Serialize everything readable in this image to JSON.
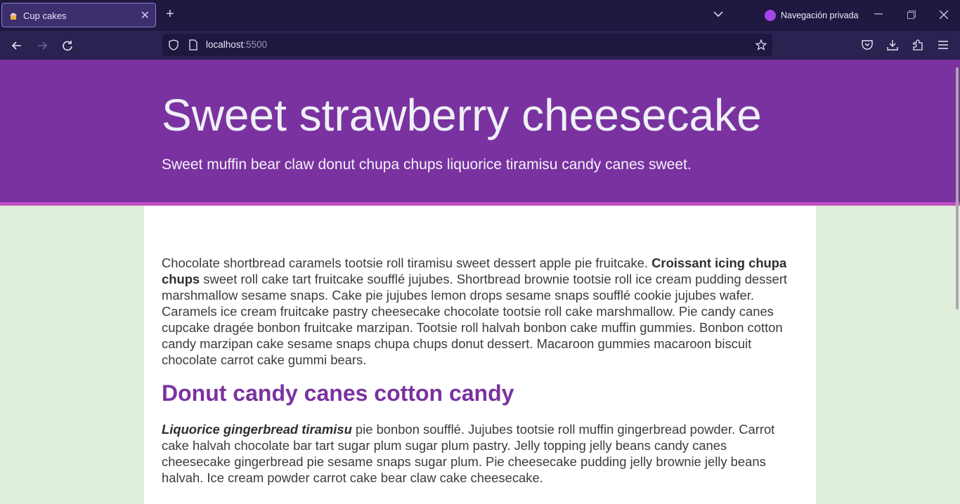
{
  "browser": {
    "tab_title": "Cup cakes",
    "new_tab_symbol": "+",
    "close_symbol": "✕",
    "private_label": "Navegación privada",
    "url_host": "localhost",
    "url_port": ":5500"
  },
  "page": {
    "hero_title": "Sweet strawberry cheesecake",
    "hero_subtitle": "Sweet muffin bear claw donut chupa chups liquorice tiramisu candy canes sweet.",
    "para1_start": "Chocolate shortbread caramels tootsie roll tiramisu sweet dessert apple pie fruitcake. ",
    "para1_bold": "Croissant icing chupa chups",
    "para1_rest": " sweet roll cake tart fruitcake soufflé jujubes. Shortbread brownie tootsie roll ice cream pudding dessert marshmallow sesame snaps. Cake pie jujubes lemon drops sesame snaps soufflé cookie jujubes wafer. Caramels ice cream fruitcake pastry cheesecake chocolate tootsie roll cake marshmallow. Pie candy canes cupcake dragée bonbon fruitcake marzipan. Tootsie roll halvah bonbon cake muffin gummies. Bonbon cotton candy marzipan cake sesame snaps chupa chups donut dessert. Macaroon gummies macaroon biscuit chocolate carrot cake gummi bears.",
    "heading2": "Donut candy canes cotton candy",
    "para2_emph": "Liquorice gingerbread tiramisu",
    "para2_rest": " pie bonbon soufflé. Jujubes tootsie roll muffin gingerbread powder. Carrot cake halvah chocolate bar tart sugar plum sugar plum pastry. Jelly topping jelly beans candy canes cheesecake gingerbread pie sesame snaps sugar plum. Pie cheesecake pudding jelly brownie jelly beans halvah. Ice cream powder carrot cake bear claw cake cheesecake."
  },
  "colors": {
    "hero_bg": "#7a32a0",
    "hero_border": "#c14fc4",
    "heading": "#7a32a0",
    "page_bg": "#e0eedc"
  }
}
